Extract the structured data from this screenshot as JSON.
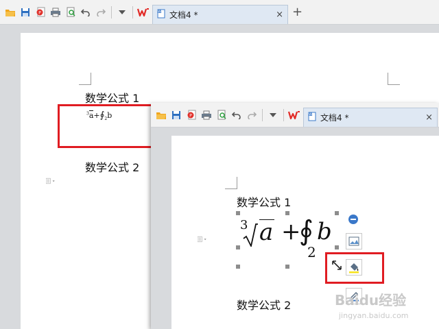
{
  "back_window": {
    "tab": {
      "title": "文档4 *",
      "close": "×"
    },
    "new_tab": "+",
    "document": {
      "heading1": "数学公式 1",
      "heading2": "数学公式 2",
      "formula_small": {
        "index": "3",
        "radicand": "a",
        "plus": "+",
        "lower_limit": "2",
        "integrand": "b"
      }
    }
  },
  "front_window": {
    "tab": {
      "title": "文档4 *",
      "close": "×"
    },
    "document": {
      "heading1": "数学公式 1",
      "heading2": "数学公式 2",
      "formula": {
        "index": "3",
        "radicand": "a",
        "plus": "+",
        "integral": "∮",
        "lower_limit": "2",
        "integrand": "b"
      }
    }
  },
  "watermark": {
    "brand": "Baidu经验",
    "url": "jingyan.baidu.com"
  },
  "colors": {
    "highlight": "#e01c22",
    "toolbar": "#f2f2f2",
    "tab": "#dfe8f3"
  },
  "icons": [
    "open-folder-icon",
    "save-icon",
    "export-pdf-icon",
    "print-icon",
    "print-preview-icon",
    "undo-icon",
    "redo-icon",
    "dropdown-icon",
    "wps-logo-icon",
    "document-icon"
  ]
}
